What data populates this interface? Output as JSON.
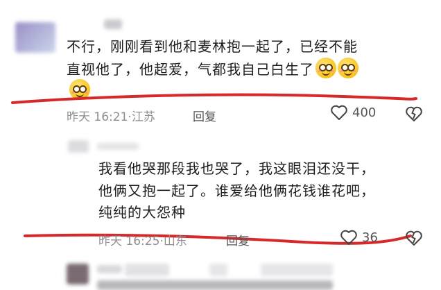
{
  "comments": [
    {
      "line1": "不行，刚刚看到他和麦林抱一起了，已经不能",
      "line2": "直视他了，他超爱，气都我自己白生了",
      "time": "昨天 16:21",
      "location": "江苏",
      "reply_label": "回复",
      "likes": "400"
    },
    {
      "line1": "我看他哭那段我也哭了，我这眼泪还没干，",
      "line2": "他俩又抱一起了。谁爱给他俩花钱谁花吧，",
      "line3": "纯纯的大怨种",
      "time": "昨天 16:25",
      "location": "山东",
      "reply_label": "回复",
      "likes": "36"
    }
  ],
  "separator": "·",
  "colors": {
    "annotation_line": "#d62a2a",
    "meta_text": "#8e8e93",
    "body_text": "#1e1e1e"
  },
  "icons": {
    "like": "heart-outline-icon",
    "dislike": "broken-heart-icon",
    "emoji": "smiling-face-emoji"
  }
}
